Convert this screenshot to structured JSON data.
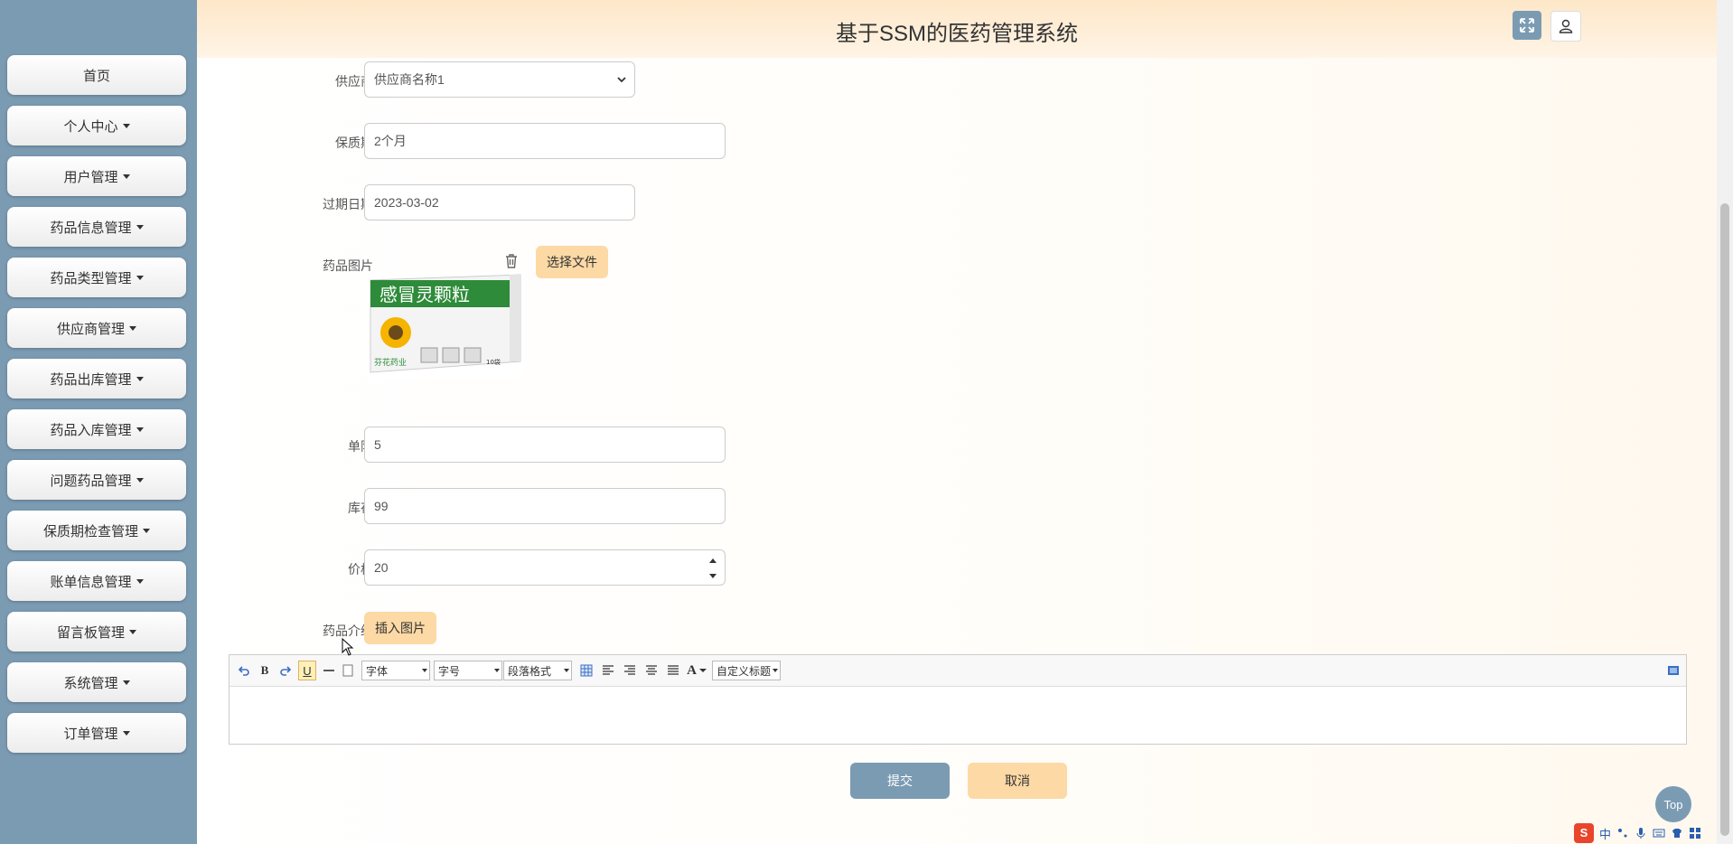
{
  "app": {
    "title": "基于SSM的医药管理系统"
  },
  "sidebar": {
    "items": [
      {
        "label": "首页",
        "dropdown": false
      },
      {
        "label": "个人中心",
        "dropdown": true
      },
      {
        "label": "用户管理",
        "dropdown": true
      },
      {
        "label": "药品信息管理",
        "dropdown": true
      },
      {
        "label": "药品类型管理",
        "dropdown": true
      },
      {
        "label": "供应商管理",
        "dropdown": true
      },
      {
        "label": "药品出库管理",
        "dropdown": true
      },
      {
        "label": "药品入库管理",
        "dropdown": true
      },
      {
        "label": "问题药品管理",
        "dropdown": true
      },
      {
        "label": "保质期检查管理",
        "dropdown": true
      },
      {
        "label": "账单信息管理",
        "dropdown": true
      },
      {
        "label": "留言板管理",
        "dropdown": true
      },
      {
        "label": "系统管理",
        "dropdown": true
      },
      {
        "label": "订单管理",
        "dropdown": true
      }
    ]
  },
  "form": {
    "supplier": {
      "label": "供应商",
      "value": "供应商名称1"
    },
    "shelf_life": {
      "label": "保质期",
      "value": "2个月"
    },
    "expiry_date": {
      "label": "过期日期",
      "value": "2023-03-02"
    },
    "image": {
      "label": "药品图片",
      "choose_file_label": "选择文件",
      "product_text": "感冒灵颗粒",
      "brand_text": "芬花药业",
      "count_text": "10袋"
    },
    "single_limit": {
      "label": "单限",
      "value": "5"
    },
    "stock": {
      "label": "库存",
      "value": "99"
    },
    "price": {
      "label": "价格",
      "value": "20"
    },
    "intro": {
      "label": "药品介绍",
      "insert_image_label": "插入图片"
    }
  },
  "editor": {
    "font_family": "字体",
    "font_size": "字号",
    "paragraph": "段落格式",
    "font_color_glyph": "A",
    "custom_heading": "自定义标题",
    "bold_glyph": "B",
    "underline_glyph": "U"
  },
  "actions": {
    "submit": "提交",
    "cancel": "取消"
  },
  "floating": {
    "top_label": "Top"
  },
  "ime": {
    "lang": "中"
  },
  "colors": {
    "sidebar": "#7b9bb3",
    "accent_orange": "#fcd9a5",
    "submit_btn": "#7b9bb3",
    "header_gradient_start": "#fde7c8"
  }
}
